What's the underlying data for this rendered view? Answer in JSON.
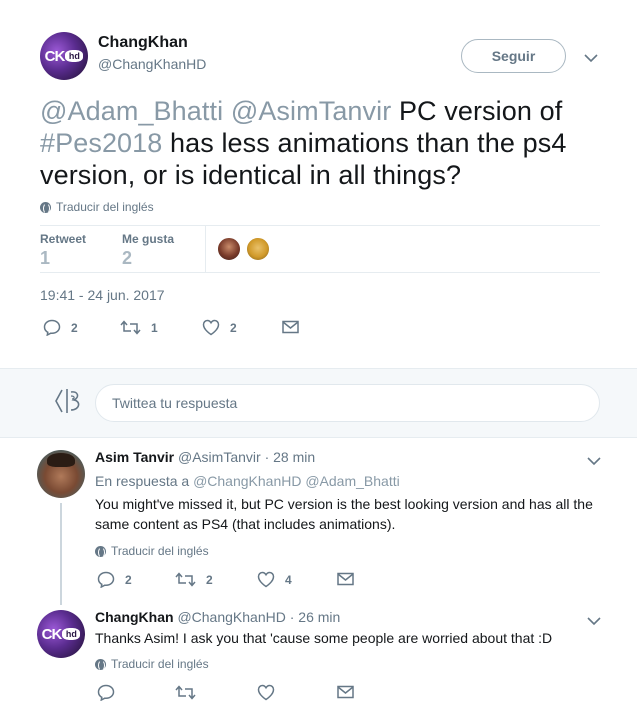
{
  "main_tweet": {
    "avatar_text": "CK",
    "avatar_badge": "hd",
    "name": "ChangKhan",
    "handle": "@ChangKhanHD",
    "follow_label": "Seguir",
    "text_parts": {
      "mention1": "@Adam_Bhatti",
      "mention2": "@AsimTanvir",
      "t1": " PC version of",
      "hashtag": "#Pes2018",
      "t2": " has less animations than the ps4",
      "t3": "version, or is identical in all things?"
    },
    "translate_label": "Traducir del inglés",
    "stats": {
      "retweet_label": "Retweet",
      "retweet_count": "1",
      "likes_label": "Me gusta",
      "likes_count": "2"
    },
    "timestamp": "19:41 - 24 jun. 2017",
    "actions": {
      "reply_count": "2",
      "retweet_count": "1",
      "like_count": "2"
    }
  },
  "reply_box": {
    "placeholder": "Twittea tu respuesta"
  },
  "replies": [
    {
      "name": "Asim Tanvir",
      "handle": "@AsimTanvir",
      "separator": "·",
      "time": "28 min",
      "reply_to_prefix": "En respuesta a",
      "reply_to_handles": "@ChangKhanHD @Adam_Bhatti",
      "text_line1": "You might've missed it, but PC version is the best looking version and has all the",
      "text_line2": "same content as PS4 (that includes animations).",
      "translate_label": "Traducir del inglés",
      "reply_count": "2",
      "retweet_count": "2",
      "like_count": "4"
    },
    {
      "name": "ChangKhan",
      "handle": "@ChangKhanHD",
      "separator": "·",
      "time": "26 min",
      "text_line1": "Thanks Asim! I ask you that 'cause some people are worried about that :D",
      "translate_label": "Traducir del inglés",
      "avatar_text": "CK",
      "avatar_badge": "hd"
    }
  ],
  "colors": {
    "text": "#14171a",
    "secondary": "#657786",
    "mention": "#8899a6",
    "border": "#e6ecf0",
    "reply_bg": "#f5f8fa"
  }
}
